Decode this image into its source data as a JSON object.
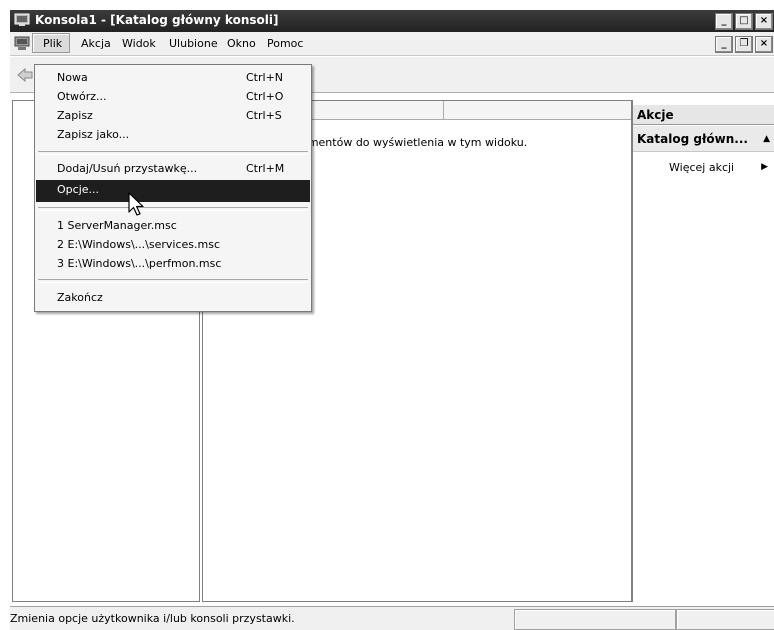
{
  "window": {
    "title": "Konsola1 - [Katalog główny konsoli]"
  },
  "menubar": {
    "items": [
      "Plik",
      "Akcja",
      "Widok",
      "Ulubione",
      "Okno",
      "Pomoc"
    ]
  },
  "file_menu": {
    "items": [
      {
        "label": "Nowa",
        "shortcut": "Ctrl+N"
      },
      {
        "label": "Otwórz...",
        "shortcut": "Ctrl+O"
      },
      {
        "label": "Zapisz",
        "shortcut": "Ctrl+S"
      },
      {
        "label": "Zapisz jako...",
        "shortcut": ""
      },
      {
        "label": "Dodaj/Usuń przystawkę...",
        "shortcut": "Ctrl+M"
      },
      {
        "label": "Opcje...",
        "shortcut": ""
      },
      {
        "label": "1 ServerManager.msc",
        "shortcut": ""
      },
      {
        "label": "2 E:\\Windows\\...\\services.msc",
        "shortcut": ""
      },
      {
        "label": "3 E:\\Windows\\...\\perfmon.msc",
        "shortcut": ""
      },
      {
        "label": "Zakończ",
        "shortcut": ""
      }
    ],
    "selected": "Opcje..."
  },
  "center": {
    "empty_message": "lementów do wyświetlenia w tym widoku."
  },
  "actions": {
    "header": "Akcje",
    "section": "Katalog główn...",
    "more": "Więcej akcji"
  },
  "statusbar": {
    "text": "Zmienia opcje użytkownika i/lub konsoli przystawki."
  },
  "icons": {
    "app": "mmc-console-icon",
    "back": "back-arrow-icon",
    "cursor": "mouse-pointer-icon"
  }
}
